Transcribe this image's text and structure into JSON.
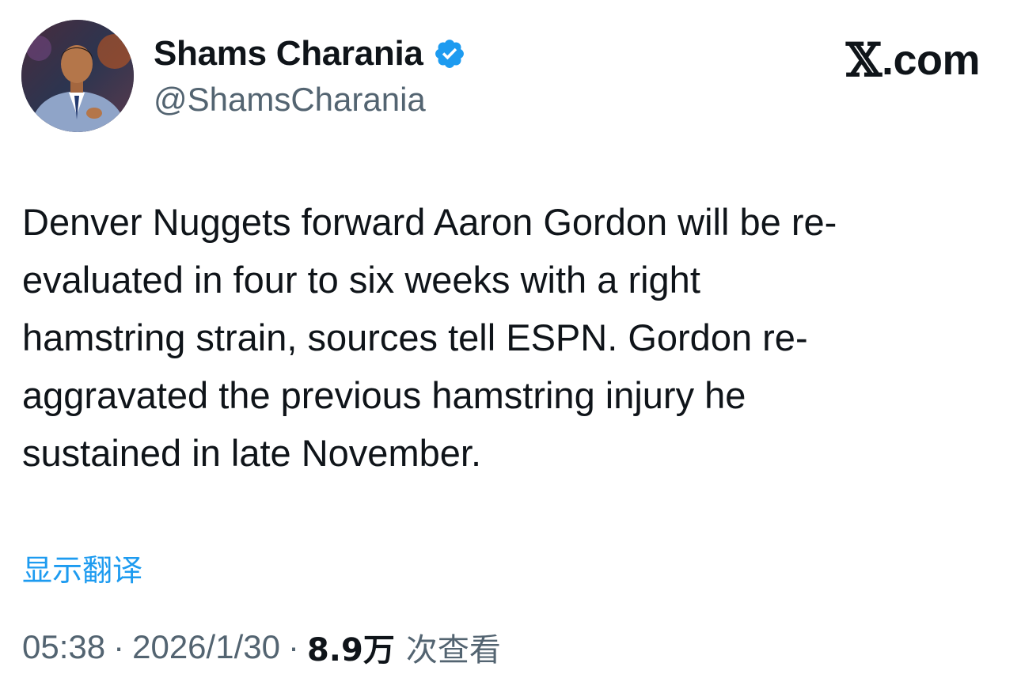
{
  "author": {
    "display_name": "Shams Charania",
    "handle": "@ShamsCharania",
    "verified": true,
    "verified_color": "#1d9bf0"
  },
  "brand": {
    "x_glyph": "𝕏",
    "domain": ".com"
  },
  "tweet": {
    "lines": [
      "Denver Nuggets forward Aaron Gordon will be re-",
      "evaluated in four to six weeks with a right",
      "hamstring strain, sources tell ESPN. Gordon re-",
      "aggravated the previous hamstring injury he",
      "sustained in late November."
    ]
  },
  "translate": {
    "label": "显示翻译",
    "color": "#1d9bf0"
  },
  "meta": {
    "time": "05:38",
    "separator": "·",
    "date": "2026/1/30",
    "views_count": "8.9万",
    "views_label": "次查看"
  },
  "icons": {
    "verified": "verified-badge-icon"
  }
}
